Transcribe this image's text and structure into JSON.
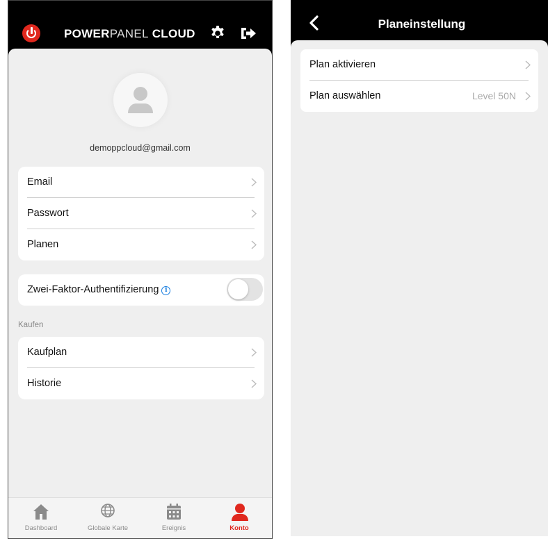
{
  "left": {
    "brand": {
      "part1": "POWER",
      "part2": "PANEL",
      "part3": "CLOUD"
    },
    "user_email": "demoppcloud@gmail.com",
    "account_items": [
      {
        "label": "Email"
      },
      {
        "label": "Passwort"
      },
      {
        "label": "Planen"
      }
    ],
    "two_factor": {
      "label": "Zwei-Faktor-Authentifizierung",
      "info_symbol": "i",
      "enabled": false
    },
    "buy_section": {
      "label": "Kaufen",
      "items": [
        {
          "label": "Kaufplan"
        },
        {
          "label": "Historie"
        }
      ]
    },
    "tabs": [
      {
        "label": "Dashboard",
        "icon": "home-icon",
        "active": false
      },
      {
        "label": "Globale Karte",
        "icon": "globe-icon",
        "active": false
      },
      {
        "label": "Ereignis",
        "icon": "calendar-icon",
        "active": false
      },
      {
        "label": "Konto",
        "icon": "user-icon",
        "active": true
      }
    ]
  },
  "right": {
    "title": "Planeinstellung",
    "items": [
      {
        "label": "Plan aktivieren",
        "value": ""
      },
      {
        "label": "Plan auswählen",
        "value": "Level 50N"
      }
    ]
  },
  "colors": {
    "accent": "#e0281e",
    "info": "#1a7fe0",
    "background": "#efefef"
  }
}
